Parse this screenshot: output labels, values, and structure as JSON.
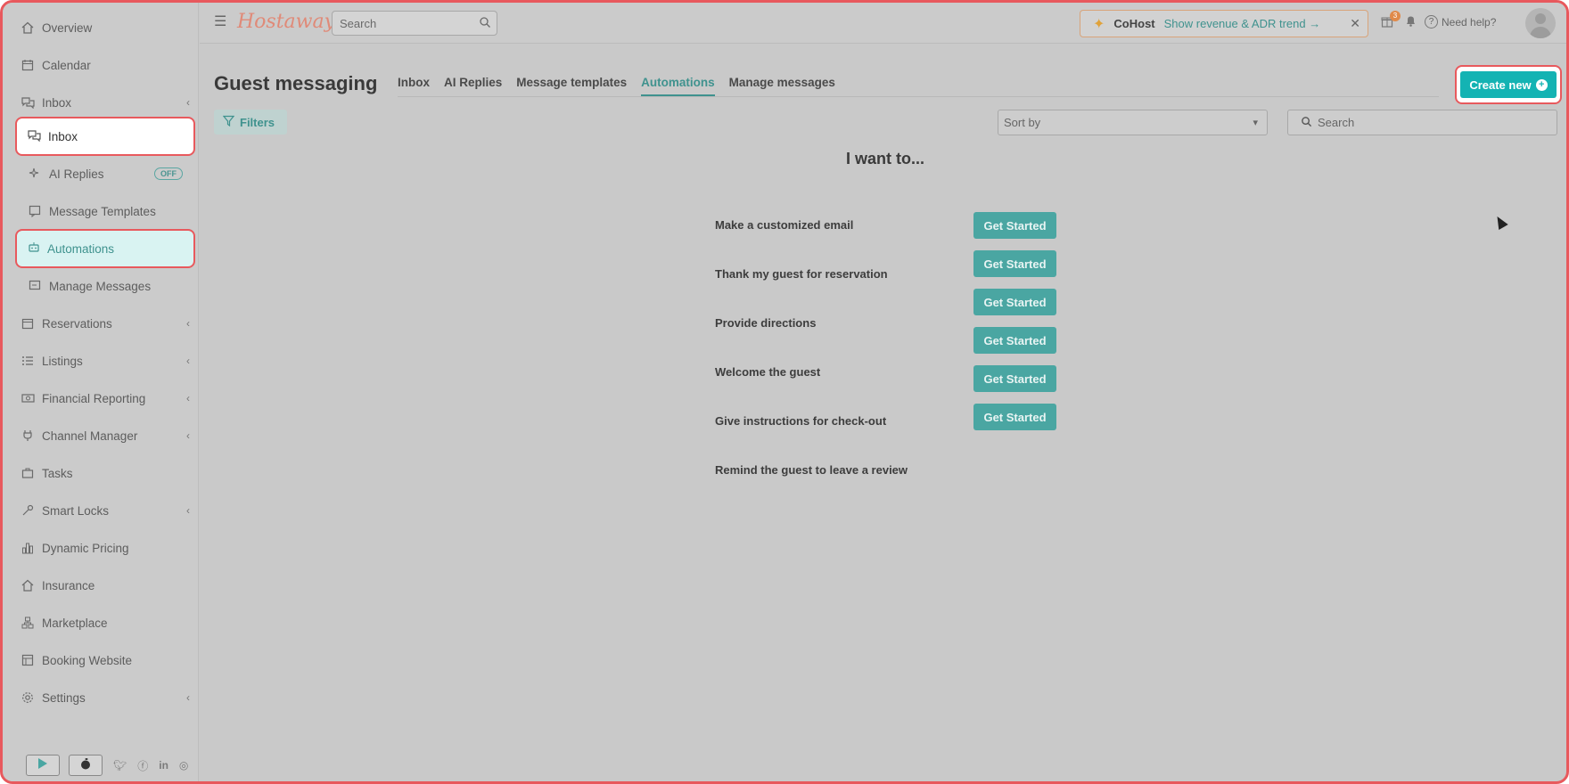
{
  "sidebar": {
    "items": [
      {
        "label": "Overview",
        "icon": "home-icon"
      },
      {
        "label": "Calendar",
        "icon": "calendar-icon"
      },
      {
        "label": "Inbox",
        "icon": "chat-icon"
      },
      {
        "label": "Reservations",
        "icon": "calendar-check-icon"
      },
      {
        "label": "Listings",
        "icon": "list-icon"
      },
      {
        "label": "Financial Reporting",
        "icon": "money-icon"
      },
      {
        "label": "Channel Manager",
        "icon": "plug-icon"
      },
      {
        "label": "Tasks",
        "icon": "briefcase-icon"
      },
      {
        "label": "Smart Locks",
        "icon": "key-icon"
      },
      {
        "label": "Dynamic Pricing",
        "icon": "bar-chart-icon"
      },
      {
        "label": "Insurance",
        "icon": "house-shield-icon"
      },
      {
        "label": "Marketplace",
        "icon": "marketplace-icon"
      },
      {
        "label": "Booking Website",
        "icon": "website-icon"
      },
      {
        "label": "Settings",
        "icon": "gear-icon"
      }
    ],
    "inbox_sub": [
      {
        "label": "Inbox"
      },
      {
        "label": "AI Replies",
        "badge": "OFF"
      },
      {
        "label": "Message Templates"
      },
      {
        "label": "Automations"
      },
      {
        "label": "Manage Messages"
      }
    ]
  },
  "topbar": {
    "logo": "Hostaway",
    "search_placeholder": "Search",
    "cohost_title": "CoHost",
    "cohost_link": "Show revenue & ADR trend →",
    "gift_count": "3",
    "help": "Need help?"
  },
  "main": {
    "title": "Guest messaging",
    "tabs": [
      "Inbox",
      "AI Replies",
      "Message templates",
      "Automations",
      "Manage messages"
    ],
    "active_tab": "Automations",
    "create_new": "Create new",
    "filters": "Filters",
    "sort_by": "Sort by",
    "search_placeholder": "Search",
    "heading": "I want to...",
    "options": [
      "Make a customized email",
      "Thank my guest for reservation",
      "Provide directions",
      "Welcome the guest",
      "Give instructions for check-out",
      "Remind the guest to leave a review"
    ],
    "get_started": "Get Started"
  },
  "colors": {
    "accent": "#14b3b3",
    "teal_text": "#3f928e",
    "highlight_border": "#e8595d"
  }
}
